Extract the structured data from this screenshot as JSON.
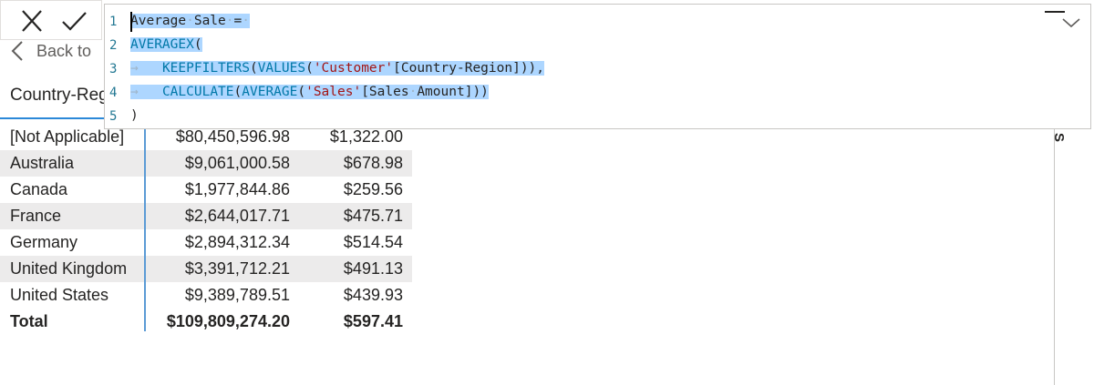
{
  "formula_bar": {
    "lines": [
      {
        "num": "1",
        "parts": [
          [
            "Average",
            "t"
          ],
          [
            "·",
            "ws"
          ],
          [
            "Sale",
            "t"
          ],
          [
            "·",
            "ws"
          ],
          [
            "=",
            "t"
          ],
          [
            "·",
            "ws"
          ]
        ]
      },
      {
        "num": "2",
        "parts": [
          [
            "AVERAGEX",
            "kw"
          ],
          [
            "(",
            "t"
          ]
        ]
      },
      {
        "num": "3",
        "parts": [
          [
            "→",
            "ws"
          ],
          [
            "   ",
            "t"
          ],
          [
            "KEEPFILTERS",
            "kw"
          ],
          [
            "(",
            "t"
          ],
          [
            "VALUES",
            "kw"
          ],
          [
            "(",
            "t"
          ],
          [
            "'Customer'",
            "str"
          ],
          [
            "[Country-Region]",
            "t"
          ],
          [
            "))",
            "t"
          ],
          [
            ",",
            "t"
          ]
        ]
      },
      {
        "num": "4",
        "parts": [
          [
            "→",
            "ws"
          ],
          [
            "   ",
            "t"
          ],
          [
            "CALCULATE",
            "kw"
          ],
          [
            "(",
            "t"
          ],
          [
            "AVERAGE",
            "kw"
          ],
          [
            "(",
            "t"
          ],
          [
            "'Sales'",
            "str"
          ],
          [
            "[Sales",
            "t"
          ],
          [
            "·",
            "ws"
          ],
          [
            "Amount]",
            "t"
          ],
          [
            "))",
            "t"
          ]
        ]
      },
      {
        "num": "5",
        "parts": [
          [
            ")",
            "t"
          ]
        ]
      }
    ]
  },
  "back": {
    "label": "Back to"
  },
  "table": {
    "column_header": "Country-Reg",
    "rows": [
      {
        "country": "[Not Applicable]",
        "sales": "$80,450,596.98",
        "avg": "$1,322.00"
      },
      {
        "country": "Australia",
        "sales": "$9,061,000.58",
        "avg": "$678.98"
      },
      {
        "country": "Canada",
        "sales": "$1,977,844.86",
        "avg": "$259.56"
      },
      {
        "country": "France",
        "sales": "$2,644,017.71",
        "avg": "$475.71"
      },
      {
        "country": "Germany",
        "sales": "$2,894,312.34",
        "avg": "$514.54"
      },
      {
        "country": "United Kingdom",
        "sales": "$3,391,712.21",
        "avg": "$491.13"
      },
      {
        "country": "United States",
        "sales": "$9,389,789.51",
        "avg": "$439.93"
      }
    ],
    "total": {
      "label": "Total",
      "sales": "$109,809,274.20",
      "avg": "$597.41"
    }
  },
  "side_pane": {
    "visible_char": "S"
  },
  "icons": {
    "cancel": "close-icon",
    "commit": "check-icon",
    "back": "chevron-left-icon",
    "expand": "chevron-down-icon"
  },
  "colors": {
    "selection": "#add6ff",
    "keyword": "#0078a8",
    "string": "#a31515",
    "line_number": "#237893",
    "table_divider": "#5b9bd5",
    "alt_row": "#ecebeb"
  }
}
